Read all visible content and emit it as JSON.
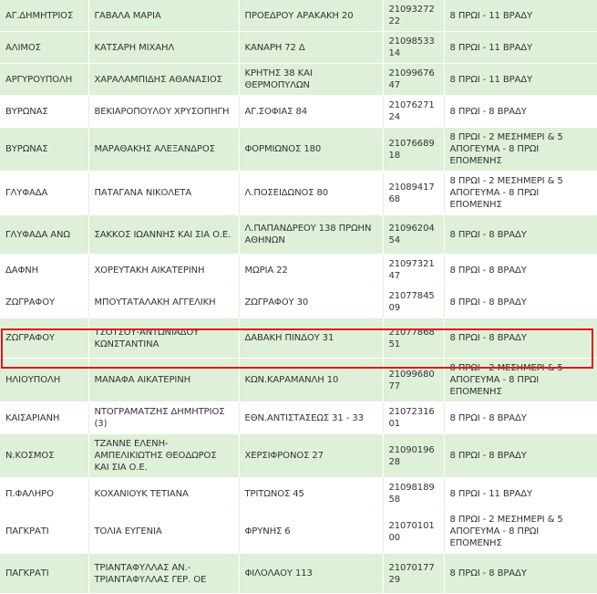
{
  "rows": [
    {
      "area": "ΑΓ.ΔΗΜΗΤΡΙΟΣ",
      "name": "ΓΑΒΑΛΑ ΜΑΡΙΑ",
      "address": "ΠΡΟΕΔΡΟΥ ΑΡΑΚΑΚΗ 20",
      "phone": "2109327222",
      "hours": "8 ΠΡΩΙ - 11 ΒΡΑΔΥ"
    },
    {
      "area": "ΑΛΙΜΟΣ",
      "name": "ΚΑΤΣΑΡΗ ΜΙΧΑΗΛ",
      "address": "ΚΑΝΑΡΗ 72 Δ",
      "phone": "2109853314",
      "hours": "8 ΠΡΩΙ - 11 ΒΡΑΔΥ"
    },
    {
      "area": "ΑΡΓΥΡΟΥΠΟΛΗ",
      "name": "ΧΑΡΑΛΑΜΠΙΔΗΣ ΑΘΑΝΑΣΙΟΣ",
      "address": "ΚΡΗΤΗΣ 38 ΚΑΙ ΘΕΡΜΟΠΥΛΩΝ",
      "phone": "2109967647",
      "hours": "8 ΠΡΩΙ - 11 ΒΡΑΔΥ"
    },
    {
      "area": "ΒΥΡΩΝΑΣ",
      "name": "ΒΕΚΙΑΡΟΠΟΥΛΟΥ ΧΡΥΣΟΠΗΓΗ",
      "address": "ΑΓ.ΣΟΦΙΑΣ 84",
      "phone": "2107627124",
      "hours": "8 ΠΡΩΙ - 8 ΒΡΑΔΥ"
    },
    {
      "area": "ΒΥΡΩΝΑΣ",
      "name": "ΜΑΡΑΘΑΚΗΣ ΑΛΕΞΑΝΔΡΟΣ",
      "address": "ΦΟΡΜΙΩΝΟΣ 180",
      "phone": "2107668918",
      "hours": "8 ΠΡΩΙ - 2 ΜΕΣΗΜΕΡΙ & 5 ΑΠΟΓΕΥΜΑ - 8 ΠΡΩΙ ΕΠΟΜΕΝΗΣ"
    },
    {
      "area": "ΓΛΥΦΑΔΑ",
      "name": "ΠΑΤΑΓΑΝΑ ΝΙΚΟΛΕΤΑ",
      "address": "Λ.ΠΟΣΕΙΔΩΝΟΣ 80",
      "phone": "2108941768",
      "hours": "8 ΠΡΩΙ - 2 ΜΕΣΗΜΕΡΙ & 5 ΑΠΟΓΕΥΜΑ - 8 ΠΡΩΙ ΕΠΟΜΕΝΗΣ"
    },
    {
      "area": "ΓΛΥΦΑΔΑ ΑΝΩ",
      "name": "ΣΑΚΚΟΣ ΙΩΑΝΝΗΣ ΚΑΙ ΣΙΑ Ο.Ε.",
      "address": "Λ.ΠΑΠΑΝΔΡΕΟΥ 138 ΠΡΩΗΝ ΑΘΗΝΩΝ",
      "phone": "2109620454",
      "hours": "8 ΠΡΩΙ - 8 ΒΡΑΔΥ"
    },
    {
      "area": "ΔΑΦΝΗ",
      "name": "ΧΟΡΕΥΤΑΚΗ ΑΙΚΑΤΕΡΙΝΗ",
      "address": "ΜΩΡΙΑ 22",
      "phone": "2109732147",
      "hours": "8 ΠΡΩΙ - 8 ΒΡΑΔΥ"
    },
    {
      "area": "ΖΩΓΡΑΦΟΥ",
      "name": "ΜΠΟΥΤΑΤΑΛΑΚΗ ΑΓΓΕΛΙΚΗ",
      "address": "ΖΩΓΡΑΦΟΥ 30",
      "phone": "2107784509",
      "hours": "8 ΠΡΩΙ - 8 ΒΡΑΔΥ"
    },
    {
      "area": "ΖΩΓΡΑΦΟΥ",
      "name": "ΤΣΟΤΣΟΥ-ΑΝΤΩΝΙΑΔΟΥ ΚΩΝΣΤΑΝΤΙΝΑ",
      "address": "ΔΑΒΑΚΗ ΠΙΝΔΟΥ 31",
      "phone": "2107786851",
      "hours": "8 ΠΡΩΙ - 8 ΒΡΑΔΥ"
    },
    {
      "area": "ΗΛΙΟΥΠΟΛΗ",
      "name": "ΜΑΝΑΦΑ ΑΙΚΑΤΕΡΙΝΗ",
      "address": "ΚΩΝ.ΚΑΡΑΜΑΝΛΗ 10",
      "phone": "2109968077",
      "hours": "8 ΠΡΩΙ - 2 ΜΕΣΗΜΕΡΙ & 5 ΑΠΟΓΕΥΜΑ - 8 ΠΡΩΙ ΕΠΟΜΕΝΗΣ"
    },
    {
      "area": "ΚΑΙΣΑΡΙΑΝΗ",
      "name": "ΝΤΟΓΡΑΜΑΤΖΗΣ ΔΗΜΗΤΡΙΟΣ (3)",
      "address": "ΕΘΝ.ΑΝΤΙΣΤΑΣΕΩΣ 31 - 33",
      "phone": "2107231601",
      "hours": "8 ΠΡΩΙ - 8 ΒΡΑΔΥ"
    },
    {
      "area": "Ν.ΚΟΣΜΟΣ",
      "name": "ΤΖΑΝΝΕ ΕΛΕΝΗ-ΑΜΠΕΛΙΚΙΩΤΗΣ ΘΕΟΔΩΡΟΣ ΚΑΙ ΣΙΑ Ο.Ε.",
      "address": "ΧΕΡΣΙΦΡΟΝΟΣ 27",
      "phone": "2109019628",
      "hours": "8 ΠΡΩΙ - 8 ΒΡΑΔΥ"
    },
    {
      "area": "Π.ΦΑΛΗΡΟ",
      "name": "ΚΟΧΑΝΙΟΥΚ ΤΕΤΙΑΝΑ",
      "address": "ΤΡΙΤΩΝΟΣ 45",
      "phone": "2109818958",
      "hours": "8 ΠΡΩΙ - 11 ΒΡΑΔΥ"
    },
    {
      "area": "ΠΑΓΚΡΑΤΙ",
      "name": "ΤΟΛΙΑ ΕΥΓΕΝΙΑ",
      "address": "ΦΡΥΝΗΣ 6",
      "phone": "2107010100",
      "hours": "8 ΠΡΩΙ - 2 ΜΕΣΗΜΕΡΙ & 5 ΑΠΟΓΕΥΜΑ - 8 ΠΡΩΙ ΕΠΟΜΕΝΗΣ"
    },
    {
      "area": "ΠΑΓΚΡΑΤΙ",
      "name": "ΤΡΙΑΝΤΑΦΥΛΛΑΣ ΑΝ.-ΤΡΙΑΝΤΑΦΥΛΛΑΣ ΓΕΡ. ΟΕ",
      "address": "ΦΙΛΟΛΑΟΥ 113",
      "phone": "2107017729",
      "hours": "8 ΠΡΩΙ - 8 ΒΡΑΔΥ"
    }
  ],
  "colors": {
    "row_green": "#dff0d8",
    "row_white": "#ffffff",
    "highlight_border": "#e3141e",
    "text": "#333333"
  }
}
